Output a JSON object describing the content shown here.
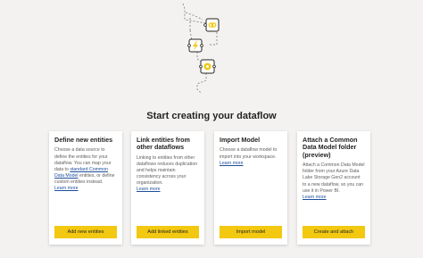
{
  "page": {
    "title": "Start creating your dataflow"
  },
  "cards": [
    {
      "title": "Define new entities",
      "desc_before": "Choose a data source to define the entities for your dataflow. You can map your data to ",
      "desc_link": "standard Common Data Model",
      "desc_after": " entities, or define custom entities instead.",
      "learn_more": "Learn more",
      "button": "Add new entities"
    },
    {
      "title": "Link entities from other dataflows",
      "desc": "Linking to entities from other dataflows reduces duplication and helps maintain consistency across your organization.",
      "learn_more": "Learn more",
      "button": "Add linked entities"
    },
    {
      "title": "Import Model",
      "desc": "Choose a dataflow model to import into your workspace.",
      "learn_more": "Learn more",
      "button": "Import model"
    },
    {
      "title": "Attach a Common Data Model folder (preview)",
      "desc": "Attach a Common Data Model folder from your Azure Data Lake Storage Gen2 account to a new dataflow, so you can use it in Power BI.",
      "learn_more": "Learn more",
      "button": "Create and attach"
    }
  ],
  "colors": {
    "accent": "#f2c811",
    "background": "#f3f2f1",
    "link": "#1f4e9c"
  },
  "icons": {
    "illustration": "dataflow-nodes-illustration",
    "node_1": "link-icon",
    "node_2": "lightning-icon",
    "node_3": "gear-icon"
  }
}
